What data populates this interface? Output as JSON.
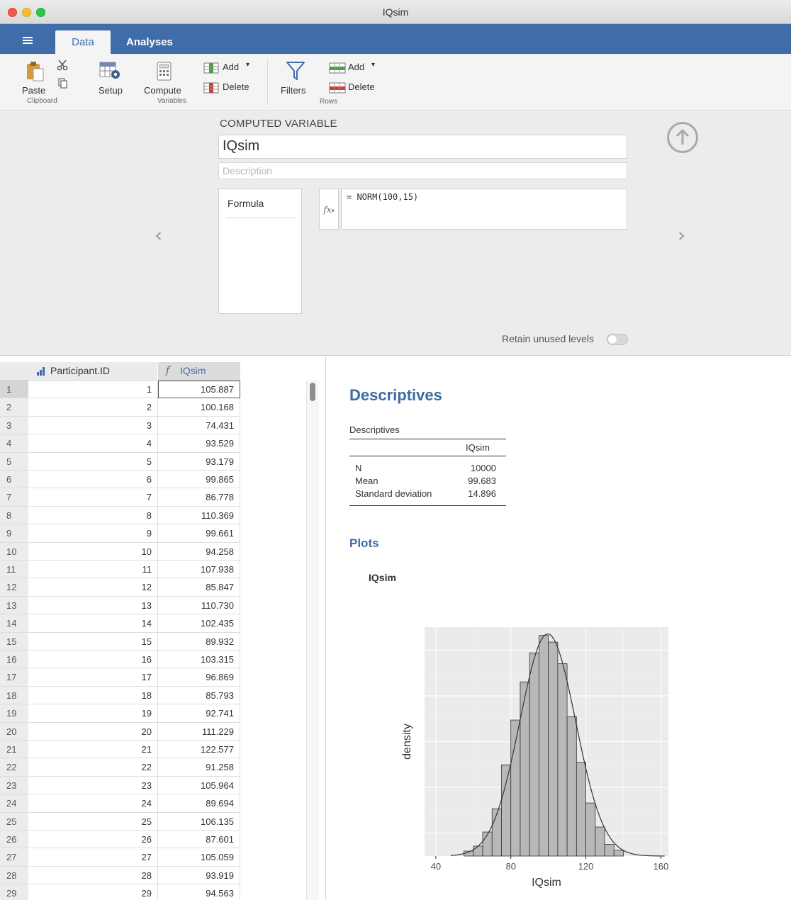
{
  "window": {
    "title": "IQsim"
  },
  "tabs": {
    "data": "Data",
    "analyses": "Analyses"
  },
  "toolbar": {
    "paste": "Paste",
    "clipboard_group": "Clipboard",
    "setup": "Setup",
    "compute": "Compute",
    "variables_group": "Variables",
    "var_add": "Add",
    "var_delete": "Delete",
    "filters": "Filters",
    "row_add": "Add",
    "row_delete": "Delete",
    "rows_group": "Rows"
  },
  "editor": {
    "heading": "COMPUTED VARIABLE",
    "name": "IQsim",
    "description_placeholder": "Description",
    "formula_label": "Formula",
    "fx_label": "fx",
    "formula": "= NORM(100,15)",
    "retain_label": "Retain unused levels",
    "retain_on": false
  },
  "spreadsheet": {
    "columns": [
      "Participant.ID",
      "IQsim"
    ],
    "rows": [
      [
        1,
        "105.887"
      ],
      [
        2,
        "100.168"
      ],
      [
        3,
        "74.431"
      ],
      [
        4,
        "93.529"
      ],
      [
        5,
        "93.179"
      ],
      [
        6,
        "99.865"
      ],
      [
        7,
        "86.778"
      ],
      [
        8,
        "110.369"
      ],
      [
        9,
        "99.661"
      ],
      [
        10,
        "94.258"
      ],
      [
        11,
        "107.938"
      ],
      [
        12,
        "85.847"
      ],
      [
        13,
        "110.730"
      ],
      [
        14,
        "102.435"
      ],
      [
        15,
        "89.932"
      ],
      [
        16,
        "103.315"
      ],
      [
        17,
        "96.869"
      ],
      [
        18,
        "85.793"
      ],
      [
        19,
        "92.741"
      ],
      [
        20,
        "111.229"
      ],
      [
        21,
        "122.577"
      ],
      [
        22,
        "91.258"
      ],
      [
        23,
        "105.964"
      ],
      [
        24,
        "89.694"
      ],
      [
        25,
        "106.135"
      ],
      [
        26,
        "87.601"
      ],
      [
        27,
        "105.059"
      ],
      [
        28,
        "93.919"
      ],
      [
        29,
        "94.563"
      ]
    ]
  },
  "results": {
    "heading": "Descriptives",
    "table_title": "Descriptives",
    "table_column": "IQsim",
    "table_rows": [
      {
        "label": "N",
        "value": "10000"
      },
      {
        "label": "Mean",
        "value": "99.683"
      },
      {
        "label": "Standard deviation",
        "value": "14.896"
      }
    ],
    "plots_heading": "Plots",
    "plot_title": "IQsim"
  },
  "chart_data": {
    "type": "bar",
    "xlabel": "IQsim",
    "ylabel": "density",
    "xlim": [
      34,
      164
    ],
    "xticks": [
      40,
      80,
      120,
      160
    ],
    "grid": true,
    "bin_width": 5,
    "bins": [
      {
        "x0": 55,
        "x1": 60,
        "density": 0.0006
      },
      {
        "x0": 60,
        "x1": 65,
        "density": 0.0012
      },
      {
        "x0": 65,
        "x1": 70,
        "density": 0.0029
      },
      {
        "x0": 70,
        "x1": 75,
        "density": 0.0057
      },
      {
        "x0": 75,
        "x1": 80,
        "density": 0.011
      },
      {
        "x0": 80,
        "x1": 85,
        "density": 0.0164
      },
      {
        "x0": 85,
        "x1": 90,
        "density": 0.021
      },
      {
        "x0": 90,
        "x1": 95,
        "density": 0.0245
      },
      {
        "x0": 95,
        "x1": 100,
        "density": 0.0266
      },
      {
        "x0": 100,
        "x1": 105,
        "density": 0.0258
      },
      {
        "x0": 105,
        "x1": 110,
        "density": 0.0232
      },
      {
        "x0": 110,
        "x1": 115,
        "density": 0.0168
      },
      {
        "x0": 115,
        "x1": 120,
        "density": 0.0113
      },
      {
        "x0": 120,
        "x1": 125,
        "density": 0.0064
      },
      {
        "x0": 125,
        "x1": 130,
        "density": 0.0035
      },
      {
        "x0": 130,
        "x1": 135,
        "density": 0.0014
      },
      {
        "x0": 135,
        "x1": 140,
        "density": 0.0007
      }
    ],
    "density_curve": {
      "mean": 99.683,
      "sd": 14.896,
      "range": [
        48,
        162
      ]
    },
    "ylim": [
      0,
      0.0276
    ]
  }
}
